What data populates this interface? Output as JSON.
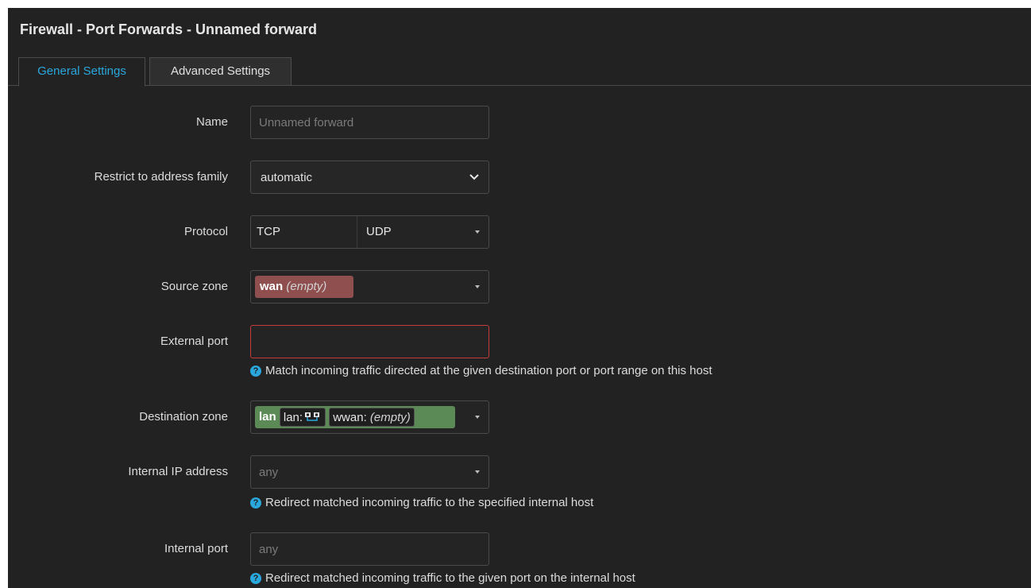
{
  "title": "Firewall - Port Forwards - Unnamed forward",
  "tabs": [
    {
      "label": "General Settings",
      "active": true
    },
    {
      "label": "Advanced Settings",
      "active": false
    }
  ],
  "fields": {
    "name": {
      "label": "Name",
      "placeholder": "Unnamed forward",
      "value": ""
    },
    "address_family": {
      "label": "Restrict to address family",
      "value": "automatic"
    },
    "protocol": {
      "label": "Protocol",
      "values": [
        "TCP",
        "UDP"
      ]
    },
    "source_zone": {
      "label": "Source zone",
      "zone": "wan",
      "note": "(empty)",
      "color": "#8f4f4f"
    },
    "external_port": {
      "label": "External port",
      "value": "",
      "help": "Match incoming traffic directed at the given destination port or port range on this host"
    },
    "dest_zone": {
      "label": "Destination zone",
      "zone": "lan",
      "nets": [
        {
          "name": "lan:",
          "icon": "network-icon"
        },
        {
          "name": "wwan:",
          "note": "(empty)"
        }
      ],
      "color": "#5c8a57"
    },
    "internal_ip": {
      "label": "Internal IP address",
      "placeholder": "any",
      "help": "Redirect matched incoming traffic to the specified internal host"
    },
    "internal_port": {
      "label": "Internal port",
      "placeholder": "any",
      "help": "Redirect matched incoming traffic to the given port on the internal host"
    }
  },
  "colors": {
    "accent": "#2aa8de",
    "error_border": "#c43b3b",
    "background": "#222222"
  }
}
